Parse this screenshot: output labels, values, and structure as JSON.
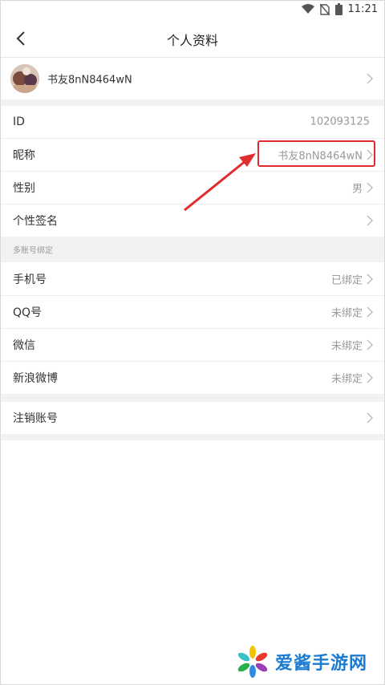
{
  "status_bar": {
    "time": "11:21"
  },
  "nav": {
    "title": "个人资料"
  },
  "profile": {
    "name": "书友8nN8464wN"
  },
  "fields": [
    {
      "label": "ID",
      "value": "102093125"
    },
    {
      "label": "昵称",
      "value": "书友8nN8464wN"
    },
    {
      "label": "性别",
      "value": "男"
    },
    {
      "label": "个性签名",
      "value": ""
    }
  ],
  "binding_section": {
    "title": "多账号绑定"
  },
  "bindings": [
    {
      "label": "手机号",
      "value": "已绑定"
    },
    {
      "label": "QQ号",
      "value": "未绑定"
    },
    {
      "label": "微信",
      "value": "未绑定"
    },
    {
      "label": "新浪微博",
      "value": "未绑定"
    }
  ],
  "logout": {
    "label": "注销账号"
  },
  "watermark": {
    "text": "爱酱手游网"
  },
  "colors": {
    "highlight": "#e02c2c",
    "watermark": "#1b7bd0",
    "gap": "#f2f2f2"
  }
}
